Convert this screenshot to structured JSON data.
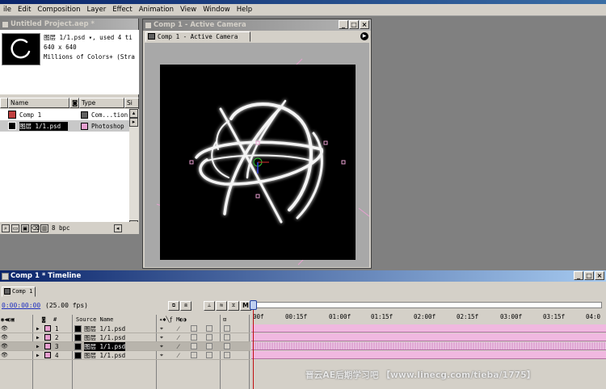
{
  "menubar": {
    "items": [
      "ile",
      "Edit",
      "Composition",
      "Layer",
      "Effect",
      "Animation",
      "View",
      "Window",
      "Help"
    ]
  },
  "project_panel": {
    "title": "Untitled Project.aep *",
    "info_line1": "图层 1/1.psd ▾, used 4 ti",
    "info_line2": "640 x 640",
    "info_line3": "Millions of Colors+ (Stra",
    "col_name": "Name",
    "col_type": "Type",
    "col_size": "Si",
    "items": [
      {
        "name": "Comp 1",
        "type": "Com...tion",
        "color": "#606060"
      },
      {
        "name": "图层 1/1.psd",
        "type": "Photoshop",
        "color": "#e8a0d0"
      }
    ],
    "bpc": "8 bpc"
  },
  "comp_window": {
    "title": "Comp 1 - Active Camera",
    "tab": "Comp 1 - Active Camera"
  },
  "timeline": {
    "title": "Comp 1 * Timeline",
    "tab": "Comp 1",
    "time": "0:00:00:00",
    "fps": "(25.00 fps)",
    "col_source": "Source Name",
    "switch_btn": "M",
    "layers": [
      {
        "num": "1",
        "name": "图层 1/1.psd"
      },
      {
        "num": "2",
        "name": "图层 1/1.psd"
      },
      {
        "num": "3",
        "name": "图层 1/1.psd"
      },
      {
        "num": "4",
        "name": "图层 1/1.psd"
      }
    ],
    "ruler": [
      "00f",
      "00:15f",
      "01:00f",
      "01:15f",
      "02:00f",
      "02:15f",
      "03:00f",
      "03:15f",
      "04:0"
    ]
  },
  "watermark": "晋云AE后期学习吧 【www.linecg.com/tieba/1775】",
  "colors": {
    "active_title": "#0a246a",
    "layer_bar": "#f0b8e0",
    "playhead": "#c01010"
  }
}
